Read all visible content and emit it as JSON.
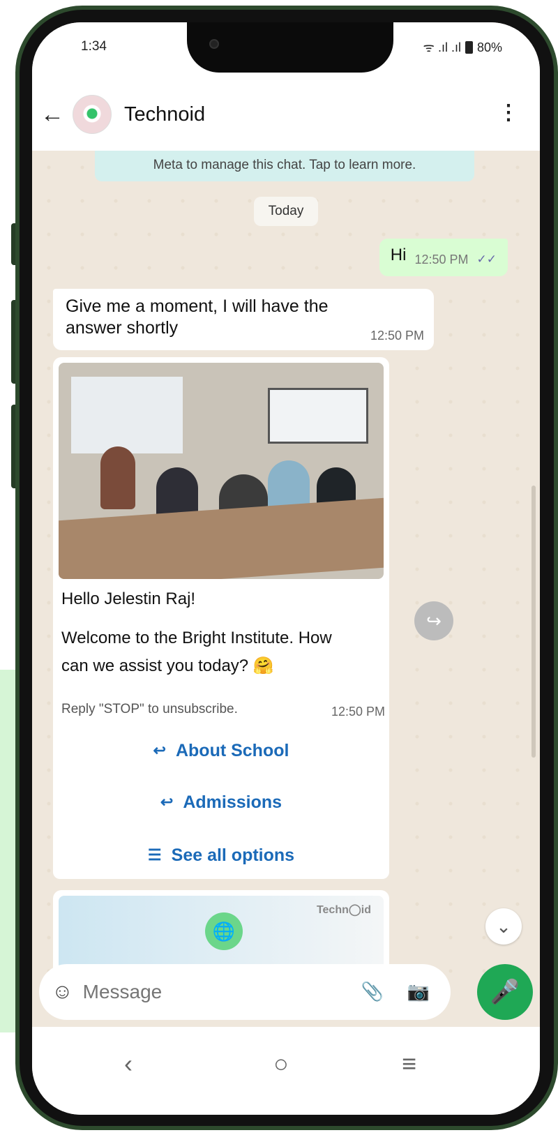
{
  "status": {
    "time": "1:34",
    "signal": "ᯤ .ıl .ıl",
    "battery": "80%"
  },
  "header": {
    "title": "Technoid",
    "back_icon": "←",
    "menu_icon": "⋮"
  },
  "notice": {
    "text": "Meta to manage this chat. Tap to learn more."
  },
  "date_chip": "Today",
  "outgoing": {
    "text": "Hi",
    "time": "12:50 PM",
    "ticks": "✓✓"
  },
  "incoming": {
    "text": "Give me a moment, I will have the answer shortly",
    "time": "12:50 PM"
  },
  "card": {
    "greeting": "Hello Jelestin Raj!",
    "body_line1": "Welcome to the Bright Institute. How",
    "body_line2": "can we assist you today? 🤗",
    "unsubscribe": "Reply \"STOP\" to unsubscribe.",
    "time": "12:50 PM"
  },
  "options": [
    {
      "label": "About School",
      "icon": "↩"
    },
    {
      "label": "Admissions",
      "icon": "↩"
    },
    {
      "label": "See all options",
      "icon": "☰"
    }
  ],
  "promo": {
    "logo": "Techn◯id",
    "globe": "🌐"
  },
  "input": {
    "placeholder": "Message",
    "emoji_icon": "☺",
    "clip_icon": "📎",
    "camera_icon": "📷",
    "mic_icon": "🎤"
  },
  "misc": {
    "forward_icon": "↪",
    "scroll_down_icon": "⌄"
  },
  "nav": {
    "back": "‹",
    "home": "○",
    "recents": "≡"
  }
}
